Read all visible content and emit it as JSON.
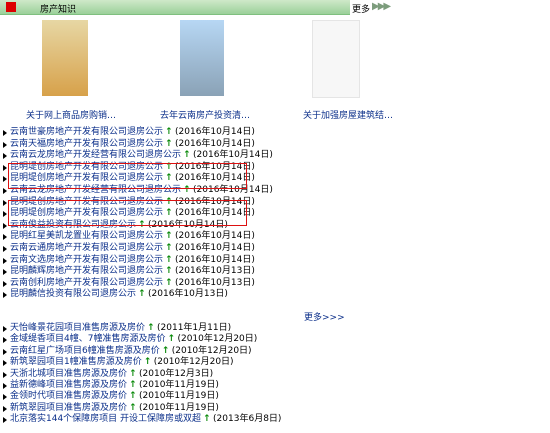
{
  "header": {
    "title": "房产知识",
    "more_label": "更多",
    "arrows": "▶▶▶"
  },
  "thumbs": [
    {
      "caption": "关于网上商品房购销…"
    },
    {
      "caption": "去年云南房产投资清…"
    },
    {
      "caption": "关于加强房屋建筑结…"
    }
  ],
  "list1": [
    {
      "text": "云南世豪房地产开发有限公司退房公示",
      "date": "(2016年10月14日)"
    },
    {
      "text": "云南天福房地产开发有限公司退房公示",
      "date": "(2016年10月14日)"
    },
    {
      "text": "云南云龙房地产开发经营有限公司退房公示",
      "date": "(2016年10月14日)"
    },
    {
      "text": "昆明堤创房地产开发有限公司退房公示",
      "date": "(2016年10月14日)"
    },
    {
      "text": "昆明堤创房地产开发有限公司退房公示",
      "date": "(2016年10月14日)"
    },
    {
      "text": "云南云龙房地产开发经营有限公司退房公示",
      "date": "(2016年10月14日)"
    },
    {
      "text": "昆明堤创房地产开发有限公司退房公示",
      "date": "(2016年10月14日)"
    },
    {
      "text": "昆明堤创房地产开发有限公司退房公示",
      "date": "(2016年10月14日)"
    },
    {
      "text": "云南俊益投资有限公司退房公示",
      "date": "(2016年10月14日)"
    },
    {
      "text": "昆明红星美凯龙置业有限公司退房公示",
      "date": "(2016年10月14日)"
    },
    {
      "text": "云南云通房地产开发有限公司退房公示",
      "date": "(2016年10月14日)"
    },
    {
      "text": "云南文选房地产开发有限公司退房公示",
      "date": "(2016年10月14日)"
    },
    {
      "text": "昆明麟辉房地产开发有限公司退房公示",
      "date": "(2016年10月13日)"
    },
    {
      "text": "云南创利房地产开发有限公司退房公示",
      "date": "(2016年10月13日)"
    },
    {
      "text": "昆明麟信投资有限公司退房公示",
      "date": "(2016年10月13日)"
    }
  ],
  "more2_label": "更多>>>",
  "list2": [
    {
      "text": "天怡峰景花园项目准售房源及房价",
      "date": "(2011年1月11日)"
    },
    {
      "text": "金域缇香项目4幢、7幢准售房源及房价",
      "date": "(2010年12月20日)"
    },
    {
      "text": "云南红星广场项目6幢准售房源及房价",
      "date": "(2010年12月20日)"
    },
    {
      "text": "新筑翠园项目1幢准售房源及房价",
      "date": "(2010年12月20日)"
    },
    {
      "text": "天浙北城项目准售房源及房价",
      "date": "(2010年12月3日)"
    },
    {
      "text": "益新德峰项目准售房源及房价",
      "date": "(2010年11月19日)"
    },
    {
      "text": "金领时代项目准售房源及房价",
      "date": "(2010年11月19日)"
    },
    {
      "text": "新筑翠园项目准售房源及房价",
      "date": "(2010年11月19日)"
    },
    {
      "text": "北京落实144个保障房项目 开设工保障房或双超",
      "date": "(2013年6月8日)"
    }
  ]
}
